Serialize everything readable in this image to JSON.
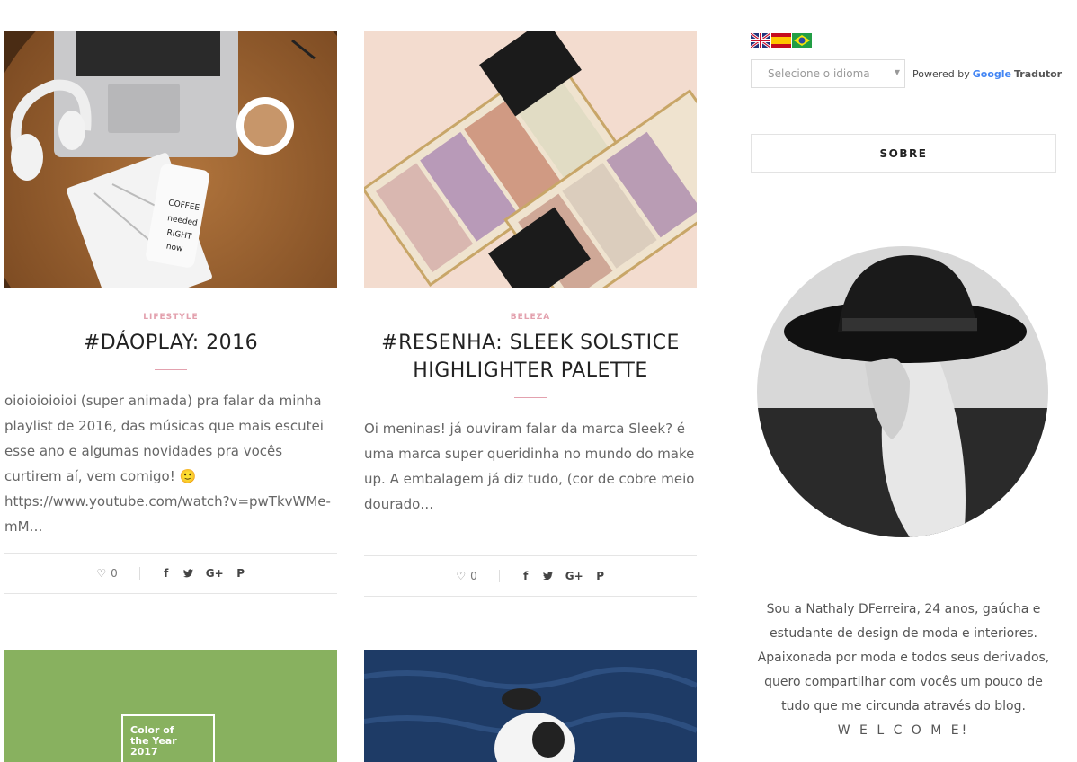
{
  "posts": [
    {
      "category": "LIFESTYLE",
      "title": "#DÁOPLAY: 2016",
      "excerpt": "oioioioioioi (super animada) pra falar da minha playlist de 2016, das músicas que mais escutei esse ano e algumas novidades pra vocês curtirem aí, vem comigo! 🙂 https://www.youtube.com/watch?v=pwTkvWMe-mM…",
      "likes": "0",
      "image_alt": "desk-flatlay-photo"
    },
    {
      "category": "BELEZA",
      "title": "#RESENHA: SLEEK SOLSTICE HIGHLIGHTER PALETTE",
      "excerpt": "Oi meninas! já ouviram falar da marca Sleek? é uma marca super queridinha no mundo do make up. A embalagem já diz tudo, (cor de cobre meio dourado…",
      "likes": "0",
      "image_alt": "highlighter-palette-photo"
    }
  ],
  "next_posts": [
    {
      "image_text": [
        "Color of",
        "the Year",
        "2017"
      ],
      "image_color": "#88b15f"
    },
    {
      "image_color": "#1d3a63"
    }
  ],
  "share_icons": [
    "f",
    "🐦",
    "G+",
    "P"
  ],
  "sidebar": {
    "flags": [
      "uk-flag",
      "spain-flag",
      "brazil-flag"
    ],
    "language_select": "Selecione o idioma",
    "powered_by": "Powered by",
    "google": "Google",
    "translator": "Tradutor",
    "about_title": "SOBRE",
    "bio": "Sou a Nathaly DFerreira, 24 anos, gaúcha e estudante de design de moda e interiores. Apaixonada por moda e todos seus derivados, quero compartilhar com vocês um pouco de tudo que me circunda através do blog.",
    "welcome": "W E L C O M E!"
  },
  "colors": {
    "accent": "#e3a1ae",
    "text": "#666666",
    "border": "#e5e5e5"
  }
}
